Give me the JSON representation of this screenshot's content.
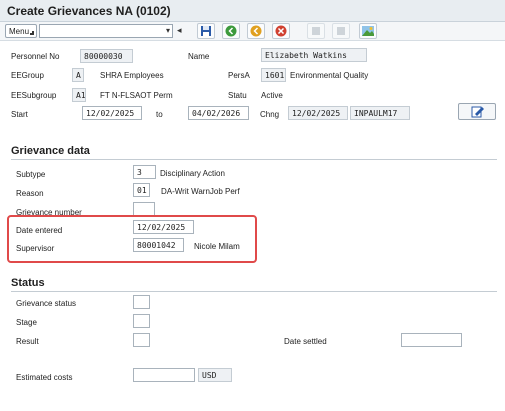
{
  "window": {
    "title": "Create Grievances NA (0102)"
  },
  "toolbar": {
    "menu_label": "Menu",
    "command_value": ""
  },
  "colors": {
    "highlight_border": "#e04a4a",
    "save_icon": "#2a5aa8",
    "back_icon": "#3c9a3c",
    "exit_icon": "#e0a020",
    "cancel_icon": "#d04030"
  },
  "header": {
    "personnel_no_label": "Personnel No",
    "personnel_no": "80000030",
    "name_label": "Name",
    "name": "Elizabeth Watkins",
    "eegroup_label": "EEGroup",
    "eegroup_code": "A",
    "eegroup_text": "SHRA Employees",
    "persa_label": "PersA",
    "persa_code": "1601",
    "persa_text": "Environmental Quality",
    "eesubgroup_label": "EESubgroup",
    "eesubgroup_code": "A1",
    "eesubgroup_text": "FT N-FLSAOT Perm",
    "statu_label": "Statu",
    "statu_value": "Active",
    "start_label": "Start",
    "start_date": "12/02/2025",
    "to_label": "to",
    "end_date": "04/02/2026",
    "chng_label": "Chng",
    "chng_date": "12/02/2025",
    "chng_user": "INPAULM17"
  },
  "grievance": {
    "section_title": "Grievance data",
    "subtype_label": "Subtype",
    "subtype_code": "3",
    "subtype_text": "Disciplinary Action",
    "reason_label": "Reason",
    "reason_code": "01",
    "reason_text": "DA-Writ WarnJob Perf",
    "number_label": "Grievance number",
    "number_value": "",
    "date_entered_label": "Date entered",
    "date_entered": "12/02/2025",
    "supervisor_label": "Supervisor",
    "supervisor_id": "80001042",
    "supervisor_name": "Nicole Milam"
  },
  "status": {
    "section_title": "Status",
    "grievance_status_label": "Grievance status",
    "grievance_status_value": "",
    "stage_label": "Stage",
    "stage_value": "",
    "result_label": "Result",
    "result_value": "",
    "date_settled_label": "Date settled",
    "date_settled_value": "",
    "estimated_costs_label": "Estimated costs",
    "estimated_costs_value": "",
    "currency": "USD"
  }
}
